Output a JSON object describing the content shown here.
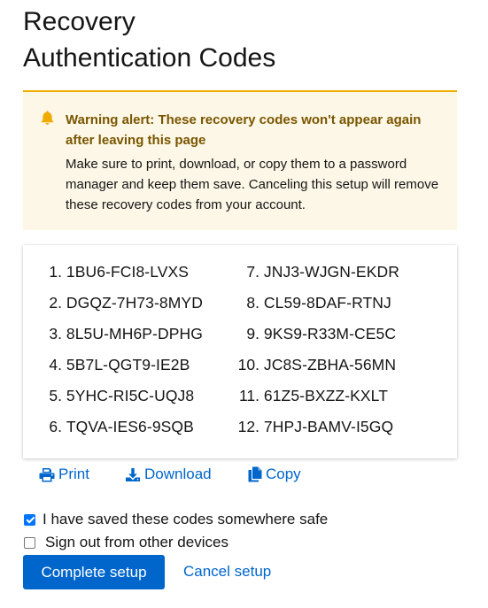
{
  "page": {
    "title_line1": "Recovery",
    "title_line2": "Authentication Codes"
  },
  "alert": {
    "icon": "bell-icon",
    "title": "Warning alert: These recovery codes won't appear again after leaving this page",
    "body": "Make sure to print, download, or copy them to a password manager and keep them save. Canceling this setup will remove these recovery codes from your account.",
    "accent_color": "#f0ab00",
    "background_color": "#fdf7e7"
  },
  "codes": {
    "left": [
      {
        "num": "1.",
        "code": "1BU6-FCI8-LVXS"
      },
      {
        "num": "2.",
        "code": "DGQZ-7H73-8MYD"
      },
      {
        "num": "3.",
        "code": "8L5U-MH6P-DPHG"
      },
      {
        "num": "4.",
        "code": "5B7L-QGT9-IE2B"
      },
      {
        "num": "5.",
        "code": "5YHC-RI5C-UQJ8"
      },
      {
        "num": "6.",
        "code": "TQVA-IES6-9SQB"
      }
    ],
    "right": [
      {
        "num": "7.",
        "code": "JNJ3-WJGN-EKDR"
      },
      {
        "num": "8.",
        "code": "CL59-8DAF-RTNJ"
      },
      {
        "num": "9.",
        "code": "9KS9-R33M-CE5C"
      },
      {
        "num": "10.",
        "code": "JC8S-ZBHA-56MN"
      },
      {
        "num": "11.",
        "code": "61Z5-BXZZ-KXLT"
      },
      {
        "num": "12.",
        "code": "7HPJ-BAMV-I5GQ"
      }
    ]
  },
  "actions": {
    "print": {
      "label": "Print",
      "icon": "print-icon"
    },
    "download": {
      "label": "Download",
      "icon": "download-icon"
    },
    "copy": {
      "label": "Copy",
      "icon": "copy-icon"
    }
  },
  "options": {
    "saved_label": "I have saved these codes somewhere safe",
    "saved_checked": true,
    "signout_label": "Sign out from other devices",
    "signout_checked": false
  },
  "buttons": {
    "complete": "Complete setup",
    "cancel": "Cancel setup"
  },
  "colors": {
    "link": "#0066cc",
    "primary": "#0066cc"
  }
}
